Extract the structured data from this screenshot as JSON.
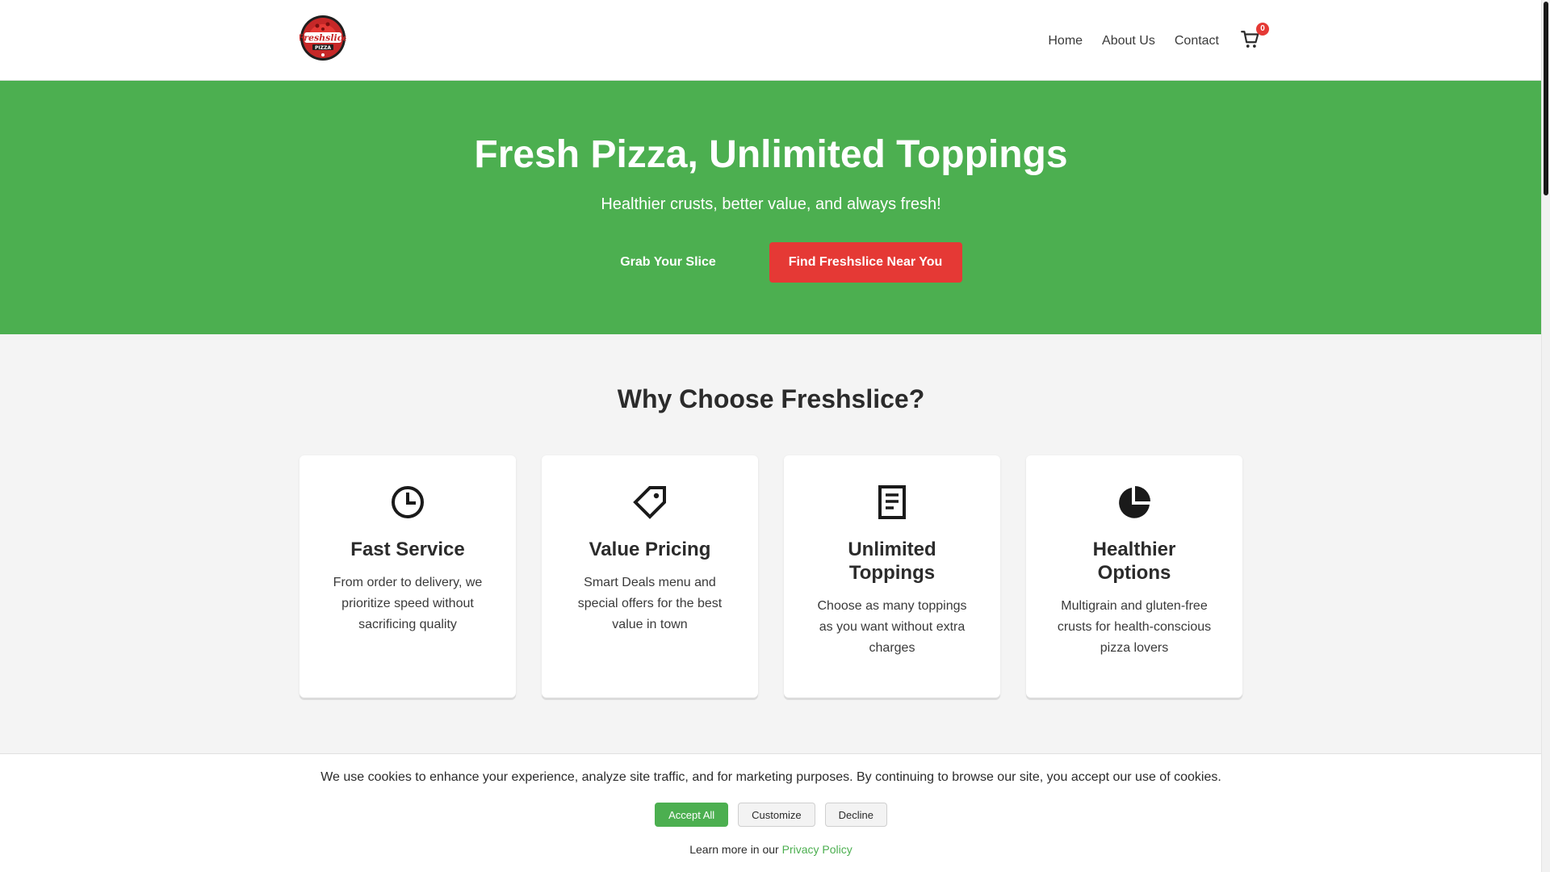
{
  "header": {
    "logo": {
      "text_top": "Freshslice",
      "text_bottom": "PIZZA",
      "icon": "freshslice-logo"
    },
    "nav": [
      {
        "label": "Home"
      },
      {
        "label": "About Us"
      },
      {
        "label": "Contact"
      }
    ],
    "cart": {
      "icon": "cart-icon",
      "count": "0"
    }
  },
  "hero": {
    "title": "Fresh Pizza, Unlimited Toppings",
    "subtitle": "Healthier crusts, better value, and always fresh!",
    "buttons": [
      {
        "label": "Grab Your Slice"
      },
      {
        "label": "Find Freshslice Near You"
      }
    ]
  },
  "features": {
    "title": "Why Choose Freshslice?",
    "cards": [
      {
        "icon": "clock-icon",
        "title": "Fast Service",
        "text": "From order to delivery, we prioritize speed without sacrificing quality"
      },
      {
        "icon": "price-tag-icon",
        "title": "Value Pricing",
        "text": "Smart Deals menu and special offers for the best value in town"
      },
      {
        "icon": "document-icon",
        "title": "Unlimited Toppings",
        "text": "Choose as many toppings as you want without extra charges"
      },
      {
        "icon": "pie-chart-icon",
        "title": "Healthier Options",
        "text": "Multigrain and gluten-free crusts for health-conscious pizza lovers"
      }
    ]
  },
  "cookie": {
    "message": "We use cookies to enhance your experience, analyze site traffic, and for marketing purposes. By continuing to browse our site, you accept our use of cookies.",
    "buttons": {
      "accept": "Accept All",
      "customize": "Customize",
      "decline": "Decline"
    },
    "learn_prefix": "Learn more in our",
    "privacy_link": "Privacy Policy"
  },
  "colors": {
    "brand_green": "#4caf50",
    "accent_red": "#e53935",
    "background": "#f4f4f4"
  }
}
